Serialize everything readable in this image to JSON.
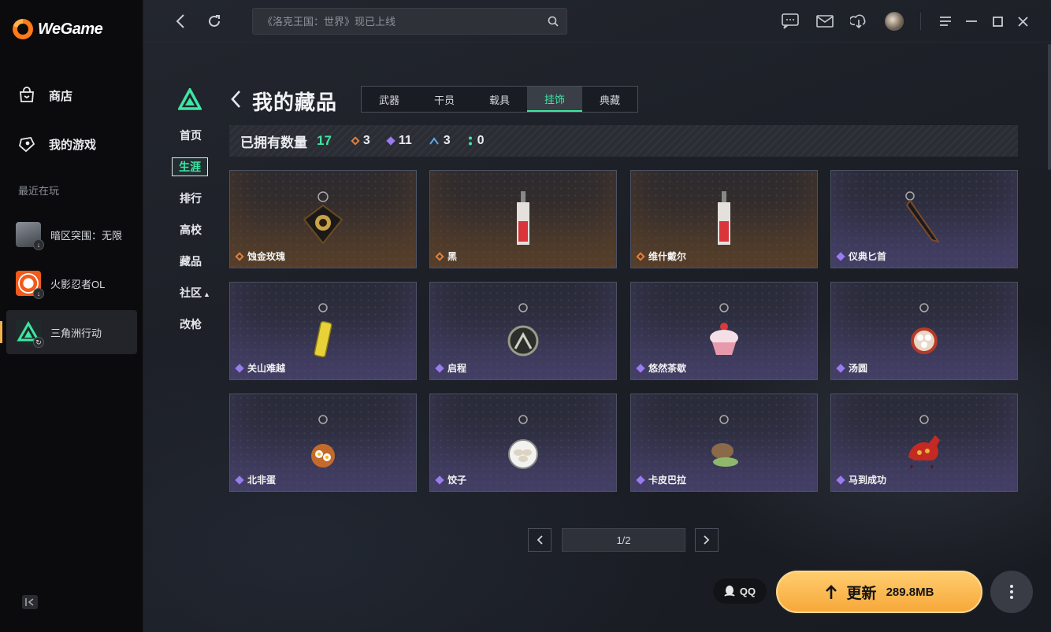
{
  "app": {
    "name": "WeGame"
  },
  "sidebar": {
    "nav": [
      {
        "label": "商店",
        "icon": "store-bag-icon"
      },
      {
        "label": "我的游戏",
        "icon": "gamepad-icon"
      }
    ],
    "recent_title": "最近在玩",
    "recent_games": [
      {
        "name": "暗区突围：无限",
        "badge": "download-icon",
        "active": false
      },
      {
        "name": "火影忍者OL",
        "badge": "download-icon",
        "active": false
      },
      {
        "name": "三角洲行动",
        "badge": "refresh-icon",
        "active": true
      }
    ]
  },
  "topbar": {
    "search_placeholder": "《洛克王国：世界》现已上线"
  },
  "game_nav": {
    "items": [
      {
        "label": "首页",
        "active": false
      },
      {
        "label": "生涯",
        "active": true
      },
      {
        "label": "排行",
        "active": false
      },
      {
        "label": "高校",
        "active": false
      },
      {
        "label": "藏品",
        "active": false
      },
      {
        "label": "社区",
        "active": false
      },
      {
        "label": "改枪",
        "active": false
      }
    ]
  },
  "page": {
    "title": "我的藏品",
    "tabs": [
      {
        "label": "武器",
        "active": false
      },
      {
        "label": "干员",
        "active": false
      },
      {
        "label": "载具",
        "active": false
      },
      {
        "label": "挂饰",
        "active": true
      },
      {
        "label": "典藏",
        "active": false
      }
    ],
    "stats": {
      "label": "已拥有数量",
      "total": "17",
      "orange": "3",
      "purple": "11",
      "blue": "3",
      "green": "0"
    },
    "items": [
      {
        "name": "蚀金玫瑰",
        "rarity": "orange"
      },
      {
        "name": "黑",
        "rarity": "orange"
      },
      {
        "name": "维什戴尔",
        "rarity": "orange"
      },
      {
        "name": "仪典匕首",
        "rarity": "purple"
      },
      {
        "name": "关山难越",
        "rarity": "purple"
      },
      {
        "name": "启程",
        "rarity": "purple"
      },
      {
        "name": "悠然茶歇",
        "rarity": "purple"
      },
      {
        "name": "汤圆",
        "rarity": "purple"
      },
      {
        "name": "北非蛋",
        "rarity": "purple"
      },
      {
        "name": "饺子",
        "rarity": "purple"
      },
      {
        "name": "卡皮巴拉",
        "rarity": "purple"
      },
      {
        "name": "马到成功",
        "rarity": "purple"
      }
    ],
    "pagination": {
      "current": "1/2"
    }
  },
  "actions": {
    "qq": "QQ",
    "update_label": "更新",
    "update_size": "289.8MB"
  },
  "colors": {
    "accent_green": "#3ee6a3",
    "orange_rarity": "#e0813a",
    "purple_rarity": "#9a7bf0",
    "blue_rarity": "#5aa4e8",
    "update_button": "#f7a83a"
  }
}
